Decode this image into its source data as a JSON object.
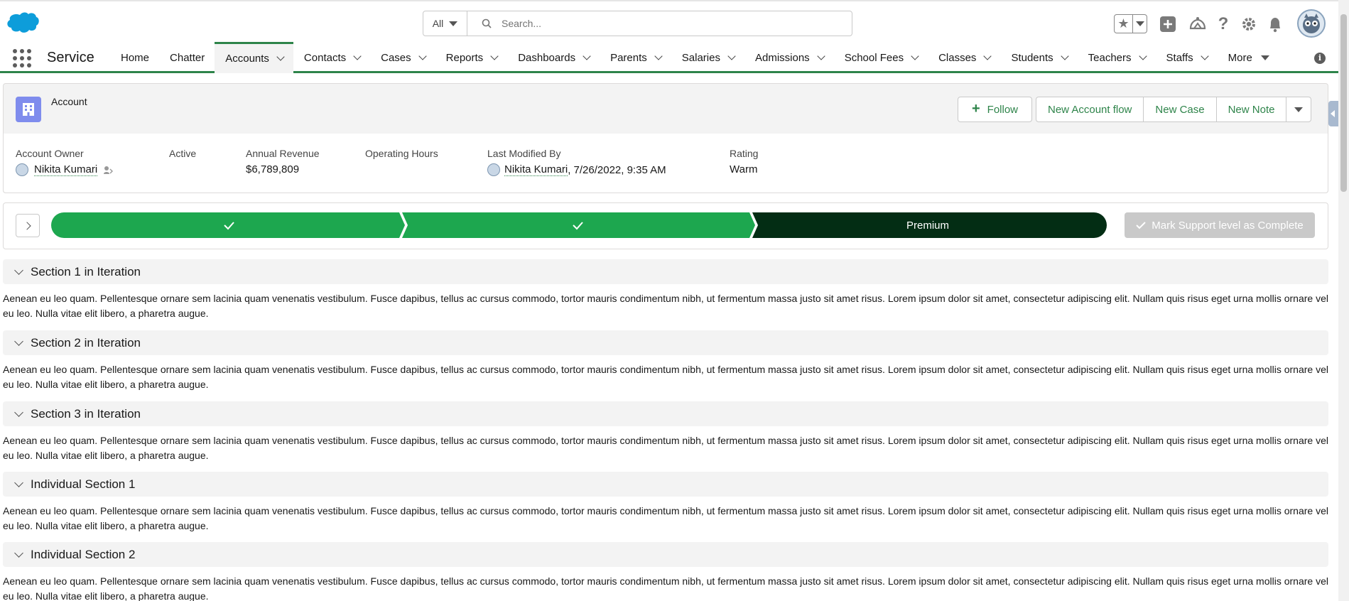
{
  "header": {
    "search_scope": "All",
    "search_placeholder": "Search..."
  },
  "nav": {
    "app_name": "Service",
    "items": [
      {
        "label": "Home",
        "dropdown": false,
        "active": false
      },
      {
        "label": "Chatter",
        "dropdown": false,
        "active": false
      },
      {
        "label": "Accounts",
        "dropdown": true,
        "active": true
      },
      {
        "label": "Contacts",
        "dropdown": true,
        "active": false
      },
      {
        "label": "Cases",
        "dropdown": true,
        "active": false
      },
      {
        "label": "Reports",
        "dropdown": true,
        "active": false
      },
      {
        "label": "Dashboards",
        "dropdown": true,
        "active": false
      },
      {
        "label": "Parents",
        "dropdown": true,
        "active": false
      },
      {
        "label": "Salaries",
        "dropdown": true,
        "active": false
      },
      {
        "label": "Admissions",
        "dropdown": true,
        "active": false
      },
      {
        "label": "School Fees",
        "dropdown": true,
        "active": false
      },
      {
        "label": "Classes",
        "dropdown": true,
        "active": false
      },
      {
        "label": "Students",
        "dropdown": true,
        "active": false
      },
      {
        "label": "Teachers",
        "dropdown": true,
        "active": false
      },
      {
        "label": "Staffs",
        "dropdown": true,
        "active": false
      }
    ],
    "more_label": "More",
    "accent_color": "#2e844a"
  },
  "record": {
    "object_label": "Account",
    "actions": {
      "follow": "Follow",
      "new_account_flow": "New Account flow",
      "new_case": "New Case",
      "new_note": "New Note"
    },
    "fields": {
      "owner_label": "Account Owner",
      "owner_value": "Nikita Kumari",
      "active_label": "Active",
      "revenue_label": "Annual Revenue",
      "revenue_value": "$6,789,809",
      "hours_label": "Operating Hours",
      "modified_label": "Last Modified By",
      "modified_user": "Nikita Kumari",
      "modified_date": ", 7/26/2022, 9:35 AM",
      "rating_label": "Rating",
      "rating_value": "Warm"
    }
  },
  "path": {
    "current_stage": "Premium",
    "completed_color": "#1da74f",
    "current_color": "#032d14",
    "mark_complete_label": "Mark Support level as Complete"
  },
  "sections": [
    {
      "title": "Section 1 in Iteration",
      "body": "Aenean eu leo quam. Pellentesque ornare sem lacinia quam venenatis vestibulum. Fusce dapibus, tellus ac cursus commodo, tortor mauris condimentum nibh, ut fermentum massa justo sit amet risus. Lorem ipsum dolor sit amet, consectetur adipiscing elit. Nullam quis risus eget urna mollis ornare vel eu leo. Nulla vitae elit libero, a pharetra augue."
    },
    {
      "title": "Section 2 in Iteration",
      "body": "Aenean eu leo quam. Pellentesque ornare sem lacinia quam venenatis vestibulum. Fusce dapibus, tellus ac cursus commodo, tortor mauris condimentum nibh, ut fermentum massa justo sit amet risus. Lorem ipsum dolor sit amet, consectetur adipiscing elit. Nullam quis risus eget urna mollis ornare vel eu leo. Nulla vitae elit libero, a pharetra augue."
    },
    {
      "title": "Section 3 in Iteration",
      "body": "Aenean eu leo quam. Pellentesque ornare sem lacinia quam venenatis vestibulum. Fusce dapibus, tellus ac cursus commodo, tortor mauris condimentum nibh, ut fermentum massa justo sit amet risus. Lorem ipsum dolor sit amet, consectetur adipiscing elit. Nullam quis risus eget urna mollis ornare vel eu leo. Nulla vitae elit libero, a pharetra augue."
    },
    {
      "title": "Individual Section 1",
      "body": "Aenean eu leo quam. Pellentesque ornare sem lacinia quam venenatis vestibulum. Fusce dapibus, tellus ac cursus commodo, tortor mauris condimentum nibh, ut fermentum massa justo sit amet risus. Lorem ipsum dolor sit amet, consectetur adipiscing elit. Nullam quis risus eget urna mollis ornare vel eu leo. Nulla vitae elit libero, a pharetra augue."
    },
    {
      "title": "Individual Section 2",
      "body": "Aenean eu leo quam. Pellentesque ornare sem lacinia quam venenatis vestibulum. Fusce dapibus, tellus ac cursus commodo, tortor mauris condimentum nibh, ut fermentum massa justo sit amet risus. Lorem ipsum dolor sit amet, consectetur adipiscing elit. Nullam quis risus eget urna mollis ornare vel eu leo. Nulla vitae elit libero, a pharetra augue."
    }
  ],
  "icons": {
    "logo": "salesforce-cloud-logo",
    "header": [
      "favorites-star-icon",
      "global-actions-plus-icon",
      "trailhead-icon",
      "help-icon",
      "setup-gear-icon",
      "notifications-bell-icon"
    ]
  }
}
